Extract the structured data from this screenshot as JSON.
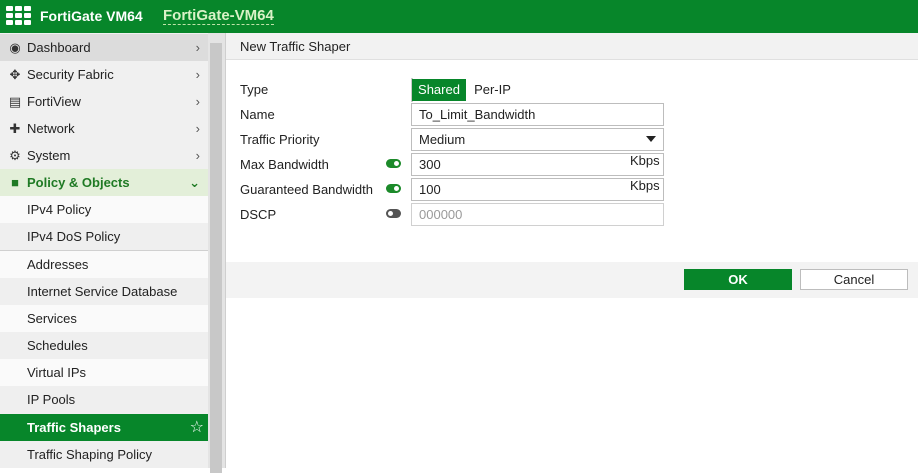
{
  "topbar": {
    "brand": "FortiGate VM64",
    "hostname": "FortiGate-VM64"
  },
  "sidebar": {
    "items": [
      {
        "label": "Dashboard",
        "icon": "dashboard-icon"
      },
      {
        "label": "Security Fabric",
        "icon": "security-fabric-icon"
      },
      {
        "label": "FortiView",
        "icon": "fortiview-icon"
      },
      {
        "label": "Network",
        "icon": "network-icon"
      },
      {
        "label": "System",
        "icon": "gear-icon"
      },
      {
        "label": "Policy & Objects",
        "icon": "policy-icon"
      }
    ],
    "subitems": [
      {
        "label": "IPv4 Policy"
      },
      {
        "label": "IPv4 DoS Policy"
      },
      {
        "label": "Addresses"
      },
      {
        "label": "Internet Service Database"
      },
      {
        "label": "Services"
      },
      {
        "label": "Schedules"
      },
      {
        "label": "Virtual IPs"
      },
      {
        "label": "IP Pools"
      },
      {
        "label": "Traffic Shapers"
      },
      {
        "label": "Traffic Shaping Policy"
      }
    ]
  },
  "form": {
    "title": "New Traffic Shaper",
    "type_label": "Type",
    "type_options": [
      "Shared",
      "Per-IP"
    ],
    "type_selected": "Shared",
    "name_label": "Name",
    "name_value": "To_Limit_Bandwidth",
    "priority_label": "Traffic Priority",
    "priority_value": "Medium",
    "max_bw_label": "Max Bandwidth",
    "max_bw_enabled": true,
    "max_bw_value": "300",
    "max_bw_unit": "Kbps",
    "guar_bw_label": "Guaranteed Bandwidth",
    "guar_bw_enabled": true,
    "guar_bw_value": "100",
    "guar_bw_unit": "Kbps",
    "dscp_label": "DSCP",
    "dscp_enabled": false,
    "dscp_placeholder": "000000"
  },
  "buttons": {
    "ok": "OK",
    "cancel": "Cancel"
  },
  "colors": {
    "brand_green": "#07862a",
    "host_text": "#d9f2c7"
  }
}
